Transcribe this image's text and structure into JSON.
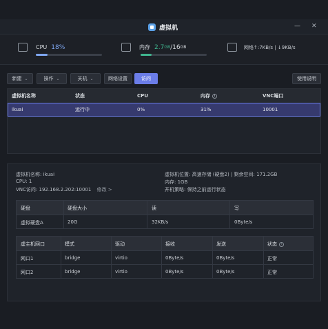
{
  "window": {
    "title": "虚拟机",
    "minimize": "—",
    "close": "✕"
  },
  "stats": {
    "cpu": {
      "label": "CPU",
      "value": "18%",
      "percent": 18
    },
    "memory": {
      "label": "内存",
      "used": "2.7",
      "used_unit": "GB",
      "sep": "/",
      "total": "16",
      "total_unit": "GB",
      "percent": 17
    },
    "network": {
      "text": "网络↑:7KB/s | ↓9KB/s"
    }
  },
  "toolbar": {
    "new": "新建",
    "operate": "操作",
    "shutdown": "关机",
    "net_settings": "网络设置",
    "access": "访问",
    "help": "使用说明"
  },
  "vm_table": {
    "headers": [
      "虚拟机名称",
      "状态",
      "CPU",
      "内存",
      "VNC端口"
    ],
    "rows": [
      [
        "ikuai",
        "运行中",
        "0%",
        "31%",
        "10001"
      ]
    ]
  },
  "details": {
    "name": "虚拟机名称: ikuai",
    "cpu": "CPU: 1",
    "vnc": "VNC访问: 192.168.2.202:10001",
    "vnc_edit": "修改 >",
    "location": "虚拟机位置: 高速存储 (硬盘2) | 剩余空间: 171.2GB",
    "memory": "内存: 1GB",
    "boot": "开机策略: 保持之前运行状态"
  },
  "disk_table": {
    "headers": [
      "硬盘",
      "硬盘大小",
      "读",
      "写"
    ],
    "rows": [
      [
        "虚拟硬盘A",
        "20G",
        "32KB/s",
        "0Byte/s"
      ]
    ]
  },
  "net_table": {
    "headers": [
      "虚主机网口",
      "模式",
      "驱动",
      "接收",
      "发送",
      "状态"
    ],
    "rows": [
      [
        "网口1",
        "bridge",
        "virtio",
        "0Byte/s",
        "0Byte/s",
        "正常"
      ],
      [
        "网口2",
        "bridge",
        "virtio",
        "0Byte/s",
        "0Byte/s",
        "正常"
      ]
    ]
  },
  "colors": {
    "accent": "#6b7de8",
    "green": "#3fb58e",
    "cpu": "#7ea6f0"
  }
}
